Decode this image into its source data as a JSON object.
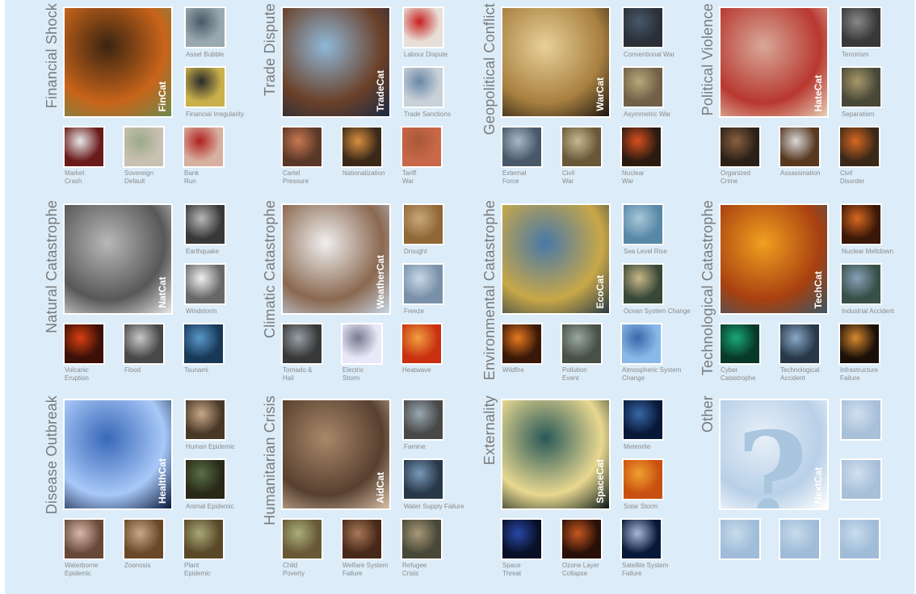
{
  "colors": {
    "background": "#dcecf8",
    "title": "#7a7a7a",
    "label": "#8a8a8a"
  },
  "categories": [
    {
      "id": "fincat",
      "title": "Financial Shock",
      "tag": "FinCat",
      "colors": [
        "#3a2410",
        "#c8641a",
        "#6b8c4e"
      ],
      "side": [
        {
          "label": "Asset Bubble",
          "colors": [
            "#4a5a66",
            "#9aa8b0"
          ]
        },
        {
          "label": "Financial Irregularity",
          "colors": [
            "#2a2a2a",
            "#c9b04a"
          ]
        }
      ],
      "bottom": [
        {
          "label": [
            "Market",
            "Crash"
          ],
          "colors": [
            "#e8e8e8",
            "#6a1a1a"
          ]
        },
        {
          "label": [
            "Sovereign",
            "Default"
          ],
          "colors": [
            "#9aaa88",
            "#c8c0b0"
          ]
        },
        {
          "label": [
            "Bank",
            "Run"
          ],
          "colors": [
            "#b02020",
            "#d8b0a0"
          ]
        }
      ]
    },
    {
      "id": "tradecat",
      "title": "Trade Dispute",
      "tag": "TradeCat",
      "colors": [
        "#8fb8d8",
        "#6a4028",
        "#1a2a44"
      ],
      "side": [
        {
          "label": "Labour Dispute",
          "colors": [
            "#c82020",
            "#e8e0d8"
          ]
        },
        {
          "label": "Trade Sanctions",
          "colors": [
            "#6a88a8",
            "#c8d0d8"
          ]
        }
      ],
      "bottom": [
        {
          "label": [
            "Cartel",
            "Pressure"
          ],
          "colors": [
            "#c87850",
            "#5a3828"
          ]
        },
        {
          "label": [
            "Nationalization"
          ],
          "colors": [
            "#d89040",
            "#3a2818"
          ]
        },
        {
          "label": [
            "Tariff",
            "War"
          ],
          "colors": [
            "#a85838",
            "#c86848"
          ]
        }
      ]
    },
    {
      "id": "warcat",
      "title": "Geopolitical Conflict",
      "tag": "WarCat",
      "colors": [
        "#e8d098",
        "#a88040",
        "#1a1410"
      ],
      "side": [
        {
          "label": "Conventional War",
          "colors": [
            "#48586a",
            "#2a3038"
          ]
        },
        {
          "label": "Asymmetric War",
          "colors": [
            "#b8a878",
            "#706048"
          ]
        }
      ],
      "bottom": [
        {
          "label": [
            "External",
            "Force"
          ],
          "colors": [
            "#a8b8c8",
            "#485868"
          ]
        },
        {
          "label": [
            "Civil",
            "War"
          ],
          "colors": [
            "#c8b890",
            "#685838"
          ]
        },
        {
          "label": [
            "Nuclear",
            "War"
          ],
          "colors": [
            "#d85020",
            "#2a1a10"
          ]
        }
      ]
    },
    {
      "id": "hatecat",
      "title": "Political Violence",
      "tag": "HateCat",
      "colors": [
        "#d8a898",
        "#b83830",
        "#e8d0b8"
      ],
      "side": [
        {
          "label": "Terrorism",
          "colors": [
            "#888888",
            "#383838"
          ]
        },
        {
          "label": "Separatism",
          "colors": [
            "#a89868",
            "#484838"
          ]
        }
      ],
      "bottom": [
        {
          "label": [
            "Organized",
            "Crime"
          ],
          "colors": [
            "#8a6040",
            "#2a2018"
          ]
        },
        {
          "label": [
            "Assassination"
          ],
          "colors": [
            "#d8d8d8",
            "#583820"
          ]
        },
        {
          "label": [
            "Civil",
            "Disorder"
          ],
          "colors": [
            "#d86820",
            "#3a2818"
          ]
        }
      ]
    },
    {
      "id": "natcat",
      "title": "Natural Catastrophe",
      "tag": "NatCat",
      "colors": [
        "#b8b8b8",
        "#585858",
        "#e8e8e8"
      ],
      "side": [
        {
          "label": "Earthquake",
          "colors": [
            "#b8b8b8",
            "#383838"
          ]
        },
        {
          "label": "Windstorm",
          "colors": [
            "#f0f0f0",
            "#686868"
          ]
        }
      ],
      "bottom": [
        {
          "label": [
            "Volcanic",
            "Eruption"
          ],
          "colors": [
            "#d84010",
            "#3a1008"
          ]
        },
        {
          "label": [
            "Flood"
          ],
          "colors": [
            "#c8c8c8",
            "#484848"
          ]
        },
        {
          "label": [
            "Tsunami"
          ],
          "colors": [
            "#5898c8",
            "#183858"
          ]
        }
      ]
    },
    {
      "id": "weathercat",
      "title": "Climatic Catastrophe",
      "tag": "WeatherCat",
      "colors": [
        "#f0f0f0",
        "#8a6850",
        "#c8d8e8"
      ],
      "side": [
        {
          "label": "Drought",
          "colors": [
            "#c8a878",
            "#906838"
          ]
        },
        {
          "label": "Freeze",
          "colors": [
            "#c8d8e8",
            "#7890a8"
          ]
        }
      ],
      "bottom": [
        {
          "label": [
            "Tornado &",
            "Hail"
          ],
          "colors": [
            "#98a0a8",
            "#383838"
          ]
        },
        {
          "label": [
            "Electric",
            "Storm"
          ],
          "colors": [
            "#787890",
            "#e8e8f8"
          ]
        },
        {
          "label": [
            "Heatwave"
          ],
          "colors": [
            "#f0a040",
            "#c83010"
          ]
        }
      ]
    },
    {
      "id": "ecocat",
      "title": "Environmental Catastrophe",
      "tag": "EcoCat",
      "colors": [
        "#4878a8",
        "#c8a848",
        "#283848"
      ],
      "side": [
        {
          "label": "Sea Level Rise",
          "colors": [
            "#a8c8d8",
            "#5888a8"
          ]
        },
        {
          "label": "Ocean System Change",
          "colors": [
            "#c8b888",
            "#384838"
          ]
        }
      ],
      "bottom": [
        {
          "label": [
            "Wildfire"
          ],
          "colors": [
            "#e87820",
            "#3a1808"
          ]
        },
        {
          "label": [
            "Pollution",
            "Event"
          ],
          "colors": [
            "#98a8a0",
            "#485048"
          ]
        },
        {
          "label": [
            "Atmospheric System",
            "Change"
          ],
          "colors": [
            "#3868a8",
            "#88b8e8"
          ]
        }
      ]
    },
    {
      "id": "techcat",
      "title": "Technological Catastrophe",
      "tag": "TechCat",
      "colors": [
        "#f0a020",
        "#a84010",
        "#385868"
      ],
      "side": [
        {
          "label": "Nuclear Meltdown",
          "colors": [
            "#d86820",
            "#3a1808"
          ]
        },
        {
          "label": "Industrial Accident",
          "colors": [
            "#88a0b8",
            "#385048"
          ]
        }
      ],
      "bottom": [
        {
          "label": [
            "Cyber",
            "Catastrophe"
          ],
          "colors": [
            "#18a878",
            "#083828"
          ]
        },
        {
          "label": [
            "Technological",
            "Accident"
          ],
          "colors": [
            "#88a8c8",
            "#283848"
          ]
        },
        {
          "label": [
            "Infrastructure",
            "Failure"
          ],
          "colors": [
            "#d88830",
            "#1a1008"
          ]
        }
      ]
    },
    {
      "id": "healthcat",
      "title": "Disease Outbreak",
      "tag": "HealthCat",
      "colors": [
        "#3868b8",
        "#a8c8f8",
        "#081838"
      ],
      "side": [
        {
          "label": "Human Epidemic",
          "colors": [
            "#c8a888",
            "#483828"
          ]
        },
        {
          "label": "Animal Epidemic",
          "colors": [
            "#587048",
            "#282818"
          ]
        }
      ],
      "bottom": [
        {
          "label": [
            "Waterborne",
            "Epidemic"
          ],
          "colors": [
            "#d8b8a8",
            "#684838"
          ]
        },
        {
          "label": [
            "Zoonosis"
          ],
          "colors": [
            "#c8a888",
            "#684828"
          ]
        },
        {
          "label": [
            "Plant",
            "Epidemic"
          ],
          "colors": [
            "#a8a878",
            "#584828"
          ]
        }
      ]
    },
    {
      "id": "aidcat",
      "title": "Humanitarian Crisis",
      "tag": "AidCat",
      "colors": [
        "#a88868",
        "#584030",
        "#d8c0a8"
      ],
      "side": [
        {
          "label": "Famine",
          "colors": [
            "#98a8b0",
            "#484848"
          ]
        },
        {
          "label": "Water Supply Failure",
          "colors": [
            "#7898b8",
            "#283848"
          ]
        }
      ],
      "bottom": [
        {
          "label": [
            "Child",
            "Poverty"
          ],
          "colors": [
            "#a8b078",
            "#685838"
          ]
        },
        {
          "label": [
            "Welfare System",
            "Failure"
          ],
          "colors": [
            "#a87858",
            "#482818"
          ]
        },
        {
          "label": [
            "Refugee",
            "Crisis"
          ],
          "colors": [
            "#a89878",
            "#484838"
          ]
        }
      ]
    },
    {
      "id": "spacecat",
      "title": "Externality",
      "tag": "SpaceCat",
      "colors": [
        "#285858",
        "#e8d890",
        "#081818"
      ],
      "side": [
        {
          "label": "Meteorite",
          "colors": [
            "#3868a8",
            "#081838"
          ]
        },
        {
          "label": "Solar Storm",
          "colors": [
            "#f0a030",
            "#c85010"
          ]
        }
      ],
      "bottom": [
        {
          "label": [
            "Space",
            "Threat"
          ],
          "colors": [
            "#2848a8",
            "#081028"
          ]
        },
        {
          "label": [
            "Ozone Layer",
            "Collapse"
          ],
          "colors": [
            "#c85820",
            "#281008"
          ]
        },
        {
          "label": [
            "Satellite System",
            "Failure"
          ],
          "colors": [
            "#a8b8d8",
            "#081838"
          ]
        }
      ]
    },
    {
      "id": "nextcat",
      "title": "Other",
      "tag": "NextCat",
      "colors": [
        "#e8f0f8",
        "#b8d0e8",
        "#ffffff"
      ],
      "side": [
        {
          "label": "",
          "colors": [
            "#d0e0f0",
            "#a8c0d8"
          ]
        },
        {
          "label": "",
          "colors": [
            "#d0e0f0",
            "#a8c0d8"
          ]
        }
      ],
      "bottom": [
        {
          "label": [
            ""
          ],
          "colors": [
            "#c8dcec",
            "#a0bcd8"
          ]
        },
        {
          "label": [
            ""
          ],
          "colors": [
            "#c8dcec",
            "#a0bcd8"
          ]
        },
        {
          "label": [
            ""
          ],
          "colors": [
            "#c8dcec",
            "#a0bcd8"
          ]
        }
      ]
    }
  ]
}
